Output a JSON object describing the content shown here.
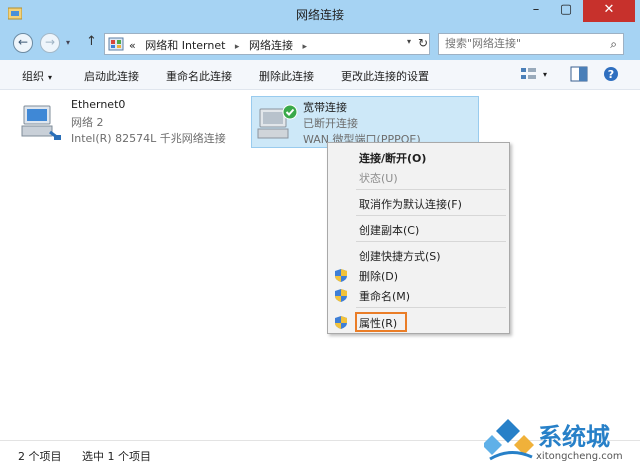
{
  "window": {
    "title": "网络连接",
    "min": "–",
    "max": "▢",
    "close": "✕"
  },
  "address": {
    "prefix": "«",
    "crumbs": [
      "网络和 Internet",
      "网络连接"
    ],
    "separator": "▸",
    "dropdown": "▾",
    "refresh": "↻",
    "back": "←",
    "forward": "→",
    "recent": "▾",
    "up": "↑"
  },
  "search": {
    "placeholder": "搜索\"网络连接\"",
    "icon": "⌕"
  },
  "toolbar": {
    "organize": "组织",
    "start_device": "启动此连接",
    "rename": "重命名此连接",
    "delete": "删除此连接",
    "change_settings": "更改此连接的设置",
    "caret": "▾",
    "help": "?"
  },
  "connections": [
    {
      "name": "Ethernet0",
      "status": "网络  2",
      "device": "Intel(R) 82574L 千兆网络连接"
    },
    {
      "name": "宽带连接",
      "status": "已断开连接",
      "device": "WAN 微型端口(PPPOE)"
    }
  ],
  "context_menu": {
    "connect": "连接/断开(O)",
    "status": "状态(U)",
    "cancel_default": "取消作为默认连接(F)",
    "copy": "创建副本(C)",
    "shortcut": "创建快捷方式(S)",
    "delete": "删除(D)",
    "rename": "重命名(M)",
    "properties": "属性(R)"
  },
  "statusbar": {
    "items": "2 个项目",
    "selected": "选中 1 个项目"
  },
  "watermark": {
    "name": "系统城",
    "url": "xitongcheng.com"
  },
  "colors": {
    "titlebar": "#a6d3f3",
    "close": "#c7312c",
    "selection": "#cde8f8",
    "highlight_border": "#ea7d27",
    "accent": "#2780c8"
  }
}
